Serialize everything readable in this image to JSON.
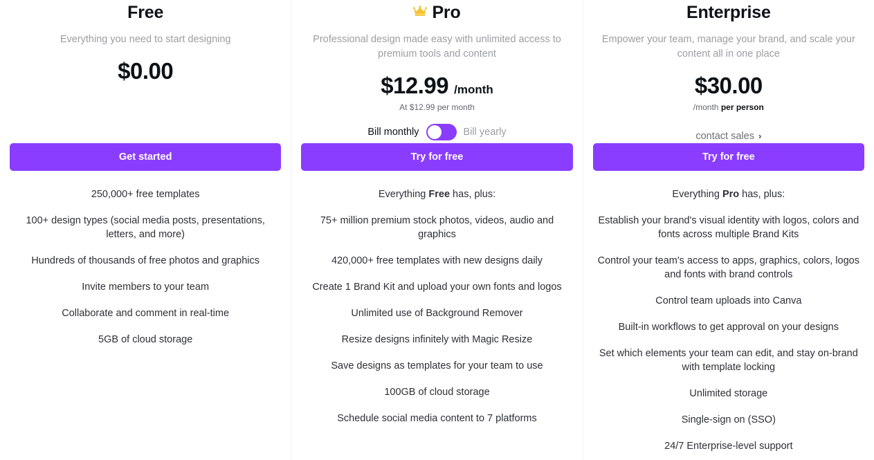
{
  "plans": [
    {
      "id": "free",
      "title": "Free",
      "has_crown": false,
      "crown_icon": "crown-icon",
      "tagline": "Everything you need to start designing",
      "price": "$0.00",
      "period": "",
      "price_note": "",
      "cta_label": "Get started",
      "features": [
        "250,000+ free templates",
        "100+ design types (social media posts, presentations, letters, and more)",
        "Hundreds of thousands of free photos and graphics",
        "Invite members to your team",
        "Collaborate and comment in real-time",
        "5GB of cloud storage"
      ]
    },
    {
      "id": "pro",
      "title": "Pro",
      "has_crown": true,
      "crown_icon": "crown-icon",
      "tagline": "Professional design made easy with unlimited access to premium tools and content",
      "price": "$12.99",
      "period": "/month",
      "price_note": "At $12.99 per month",
      "billing": {
        "monthly_label": "Bill monthly",
        "yearly_label": "Bill yearly",
        "selected": "monthly"
      },
      "cta_label": "Try for free",
      "features_intro": {
        "prefix": "Everything ",
        "bold": "Free",
        "suffix": " has, plus:"
      },
      "features": [
        "75+ million premium stock photos, videos, audio and graphics",
        "420,000+ free templates with new designs daily",
        "Create 1 Brand Kit and upload your own fonts and logos",
        "Unlimited use of Background Remover",
        "Resize designs infinitely with Magic Resize",
        "Save designs as templates for your team to use",
        "100GB of cloud storage",
        "Schedule social media content to 7 platforms"
      ]
    },
    {
      "id": "enterprise",
      "title": "Enterprise",
      "has_crown": false,
      "crown_icon": "crown-icon",
      "tagline": "Empower your team, manage your brand, and scale your content all in one place",
      "price": "$30.00",
      "period": "",
      "price_note_prefix": "/month ",
      "price_note_bold": "per person",
      "contact_sales_label": "contact sales",
      "chevron_icon": "chevron-right-icon",
      "cta_label": "Try for free",
      "features_intro": {
        "prefix": "Everything ",
        "bold": "Pro",
        "suffix": " has, plus:"
      },
      "features": [
        "Establish your brand's visual identity with logos, colors and fonts across multiple Brand Kits",
        "Control your team's access to apps, graphics, colors, logos and fonts with brand controls",
        "Control team uploads into Canva",
        "Built-in workflows to get approval on your designs",
        "Set which elements your team can edit, and stay on-brand with template locking",
        "Unlimited storage",
        "Single-sign on (SSO)",
        "24/7 Enterprise-level support"
      ]
    }
  ],
  "colors": {
    "accent": "#8b3dff",
    "text_primary": "#0d1216",
    "text_secondary": "#2c3036",
    "text_muted": "#9a9ea3",
    "crown_gold": "#f5c332",
    "divider": "#f2f2f4"
  },
  "glyphs": {
    "crown": "♛",
    "chevron_right": "›"
  }
}
